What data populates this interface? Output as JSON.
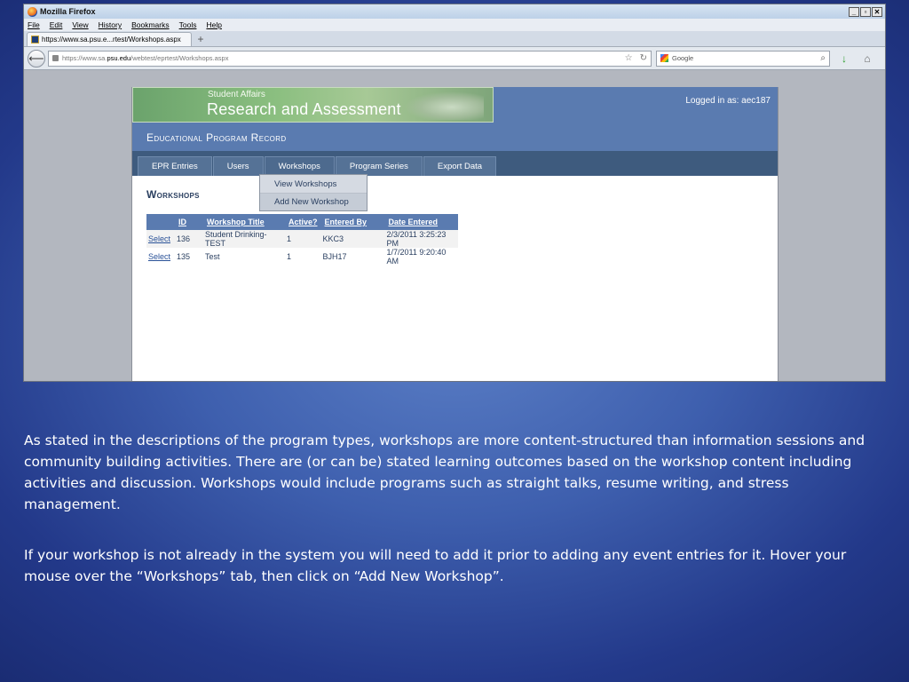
{
  "browser": {
    "window_title": "Mozilla Firefox",
    "menu": [
      "File",
      "Edit",
      "View",
      "History",
      "Bookmarks",
      "Tools",
      "Help"
    ],
    "tab_title": "https://www.sa.psu.e...rtest/Workshops.aspx",
    "new_tab_symbol": "+",
    "url_prefix": "https://www.sa.",
    "url_domain": "psu.edu",
    "url_path": "/webtest/eprtest/Workshops.aspx",
    "search_placeholder": "Google"
  },
  "site": {
    "banner_small": "Student Affairs",
    "banner_big": "Research and Assessment",
    "logged_in": "Logged in as: aec187",
    "app_title": "Educational Program Record",
    "nav_tabs": [
      "EPR Entries",
      "Users",
      "Workshops",
      "Program Series",
      "Export Data"
    ],
    "dropdown_items": [
      "View Workshops",
      "Add New Workshop"
    ],
    "page_heading": "Workshops"
  },
  "table": {
    "columns": [
      "ID",
      "Workshop Title",
      "Active?",
      "Entered By",
      "Date Entered"
    ],
    "rows": [
      {
        "select": "Select",
        "id": "136",
        "title": "Student Drinking-TEST",
        "active": "1",
        "entered_by": "KKC3",
        "date": "2/3/2011 3:25:23 PM"
      },
      {
        "select": "Select",
        "id": "135",
        "title": "Test",
        "active": "1",
        "entered_by": "BJH17",
        "date": "1/7/2011 9:20:40 AM"
      }
    ]
  },
  "slide": {
    "paragraph1": "As stated in the descriptions of the program types, workshops are more content-structured than information sessions and community building activities. There are (or can be) stated learning outcomes based on the workshop content including activities and discussion. Workshops would include programs such as straight talks, resume writing, and stress management.",
    "paragraph2": "If your workshop is not already in the system you will need to add it prior to adding any event entries for it. Hover your mouse over the “Workshops” tab, then click on “Add New Workshop”."
  }
}
